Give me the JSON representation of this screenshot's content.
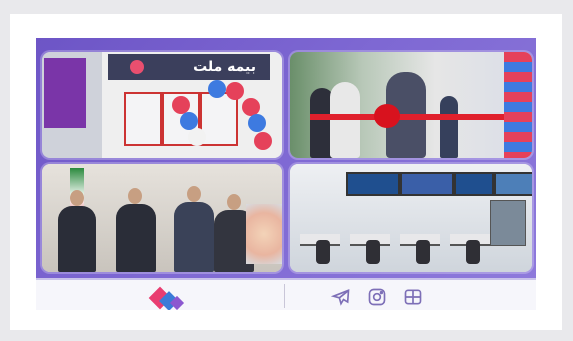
{
  "images": [
    {
      "name": "branch-storefront",
      "sign_text": "بیمه ملت"
    },
    {
      "name": "ribbon-cutting"
    },
    {
      "name": "handshake"
    },
    {
      "name": "office-interior"
    }
  ],
  "footer": {
    "logo": "bime-mellat-logo",
    "social_icons": [
      "telegram-icon",
      "instagram-icon",
      "aparat-icon"
    ]
  },
  "colors": {
    "frame_purple": "#7e68d3",
    "accent_pink": "#e93d71",
    "accent_blue": "#3b7bd8",
    "icon_color": "#7d6fb7"
  }
}
